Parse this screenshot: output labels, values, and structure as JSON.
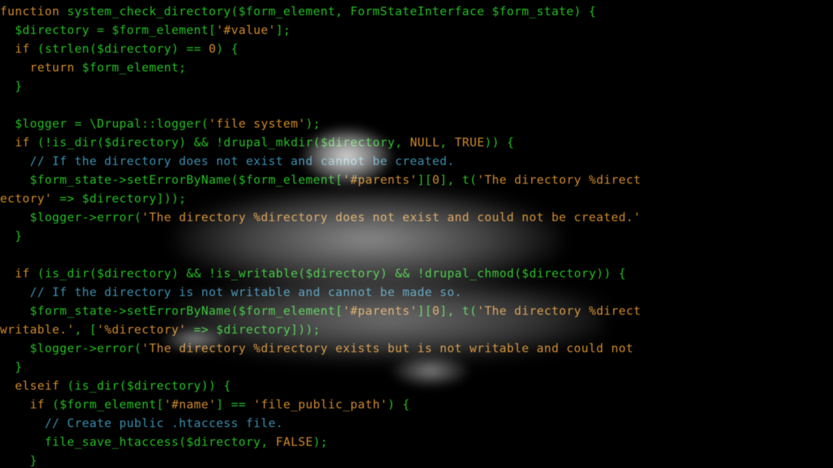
{
  "code": {
    "lines": [
      [
        {
          "t": "function ",
          "c": "kw"
        },
        {
          "t": "system_check_directory",
          "c": "fn"
        },
        {
          "t": "(",
          "c": "punc"
        },
        {
          "t": "$form_element",
          "c": "var"
        },
        {
          "t": ", ",
          "c": "punc"
        },
        {
          "t": "FormStateInterface ",
          "c": "cls"
        },
        {
          "t": "$form_state",
          "c": "var"
        },
        {
          "t": ") {",
          "c": "punc"
        }
      ],
      [
        {
          "t": "  ",
          "c": "punc"
        },
        {
          "t": "$directory",
          "c": "var"
        },
        {
          "t": " = ",
          "c": "op"
        },
        {
          "t": "$form_element",
          "c": "var"
        },
        {
          "t": "[",
          "c": "punc"
        },
        {
          "t": "'#value'",
          "c": "str"
        },
        {
          "t": "];",
          "c": "punc"
        }
      ],
      [
        {
          "t": "  ",
          "c": "punc"
        },
        {
          "t": "if ",
          "c": "kw"
        },
        {
          "t": "(",
          "c": "punc"
        },
        {
          "t": "strlen",
          "c": "fn"
        },
        {
          "t": "(",
          "c": "punc"
        },
        {
          "t": "$directory",
          "c": "var"
        },
        {
          "t": ") == ",
          "c": "op"
        },
        {
          "t": "0",
          "c": "num"
        },
        {
          "t": ") {",
          "c": "punc"
        }
      ],
      [
        {
          "t": "    ",
          "c": "punc"
        },
        {
          "t": "return ",
          "c": "kw"
        },
        {
          "t": "$form_element",
          "c": "var"
        },
        {
          "t": ";",
          "c": "punc"
        }
      ],
      [
        {
          "t": "  }",
          "c": "punc"
        }
      ],
      [
        {
          "t": " ",
          "c": "punc"
        }
      ],
      [
        {
          "t": "  ",
          "c": "punc"
        },
        {
          "t": "$logger",
          "c": "var"
        },
        {
          "t": " = ",
          "c": "op"
        },
        {
          "t": "\\Drupal",
          "c": "cls"
        },
        {
          "t": "::",
          "c": "op"
        },
        {
          "t": "logger",
          "c": "fn"
        },
        {
          "t": "(",
          "c": "punc"
        },
        {
          "t": "'file system'",
          "c": "str"
        },
        {
          "t": ");",
          "c": "punc"
        }
      ],
      [
        {
          "t": "  ",
          "c": "punc"
        },
        {
          "t": "if ",
          "c": "kw"
        },
        {
          "t": "(!",
          "c": "op"
        },
        {
          "t": "is_dir",
          "c": "fn"
        },
        {
          "t": "(",
          "c": "punc"
        },
        {
          "t": "$directory",
          "c": "var"
        },
        {
          "t": ") && !",
          "c": "op"
        },
        {
          "t": "drupal_mkdir",
          "c": "fn"
        },
        {
          "t": "(",
          "c": "punc"
        },
        {
          "t": "$directory",
          "c": "var"
        },
        {
          "t": ", ",
          "c": "punc"
        },
        {
          "t": "NULL",
          "c": "bool"
        },
        {
          "t": ", ",
          "c": "punc"
        },
        {
          "t": "TRUE",
          "c": "bool"
        },
        {
          "t": ")) {",
          "c": "punc"
        }
      ],
      [
        {
          "t": "    ",
          "c": "punc"
        },
        {
          "t": "// If the directory does not exist and cannot be created.",
          "c": "com"
        }
      ],
      [
        {
          "t": "    ",
          "c": "punc"
        },
        {
          "t": "$form_state",
          "c": "var"
        },
        {
          "t": "->",
          "c": "op"
        },
        {
          "t": "setErrorByName",
          "c": "fn"
        },
        {
          "t": "(",
          "c": "punc"
        },
        {
          "t": "$form_element",
          "c": "var"
        },
        {
          "t": "[",
          "c": "punc"
        },
        {
          "t": "'#parents'",
          "c": "str"
        },
        {
          "t": "][",
          "c": "punc"
        },
        {
          "t": "0",
          "c": "num"
        },
        {
          "t": "], ",
          "c": "punc"
        },
        {
          "t": "t",
          "c": "fn"
        },
        {
          "t": "(",
          "c": "punc"
        },
        {
          "t": "'The directory %direct",
          "c": "str"
        }
      ],
      [
        {
          "t": "ectory'",
          "c": "str"
        },
        {
          "t": " => ",
          "c": "op"
        },
        {
          "t": "$directory",
          "c": "var"
        },
        {
          "t": "]));",
          "c": "punc"
        }
      ],
      [
        {
          "t": "    ",
          "c": "punc"
        },
        {
          "t": "$logger",
          "c": "var"
        },
        {
          "t": "->",
          "c": "op"
        },
        {
          "t": "error",
          "c": "fn"
        },
        {
          "t": "(",
          "c": "punc"
        },
        {
          "t": "'The directory %directory does not exist and could not be created.'",
          "c": "str"
        }
      ],
      [
        {
          "t": "  }",
          "c": "punc"
        }
      ],
      [
        {
          "t": " ",
          "c": "punc"
        }
      ],
      [
        {
          "t": "  ",
          "c": "punc"
        },
        {
          "t": "if ",
          "c": "kw"
        },
        {
          "t": "(",
          "c": "punc"
        },
        {
          "t": "is_dir",
          "c": "fn"
        },
        {
          "t": "(",
          "c": "punc"
        },
        {
          "t": "$directory",
          "c": "var"
        },
        {
          "t": ") && !",
          "c": "op"
        },
        {
          "t": "is_writable",
          "c": "fn"
        },
        {
          "t": "(",
          "c": "punc"
        },
        {
          "t": "$directory",
          "c": "var"
        },
        {
          "t": ") && !",
          "c": "op"
        },
        {
          "t": "drupal_chmod",
          "c": "fn"
        },
        {
          "t": "(",
          "c": "punc"
        },
        {
          "t": "$directory",
          "c": "var"
        },
        {
          "t": ")) {",
          "c": "punc"
        }
      ],
      [
        {
          "t": "    ",
          "c": "punc"
        },
        {
          "t": "// If the directory is not writable and cannot be made so.",
          "c": "com"
        }
      ],
      [
        {
          "t": "    ",
          "c": "punc"
        },
        {
          "t": "$form_state",
          "c": "var"
        },
        {
          "t": "->",
          "c": "op"
        },
        {
          "t": "setErrorByName",
          "c": "fn"
        },
        {
          "t": "(",
          "c": "punc"
        },
        {
          "t": "$form_element",
          "c": "var"
        },
        {
          "t": "[",
          "c": "punc"
        },
        {
          "t": "'#parents'",
          "c": "str"
        },
        {
          "t": "][",
          "c": "punc"
        },
        {
          "t": "0",
          "c": "num"
        },
        {
          "t": "], ",
          "c": "punc"
        },
        {
          "t": "t",
          "c": "fn"
        },
        {
          "t": "(",
          "c": "punc"
        },
        {
          "t": "'The directory %direct",
          "c": "str"
        }
      ],
      [
        {
          "t": "writable.'",
          "c": "str"
        },
        {
          "t": ", [",
          "c": "punc"
        },
        {
          "t": "'%directory'",
          "c": "str"
        },
        {
          "t": " => ",
          "c": "op"
        },
        {
          "t": "$directory",
          "c": "var"
        },
        {
          "t": "]));",
          "c": "punc"
        }
      ],
      [
        {
          "t": "    ",
          "c": "punc"
        },
        {
          "t": "$logger",
          "c": "var"
        },
        {
          "t": "->",
          "c": "op"
        },
        {
          "t": "error",
          "c": "fn"
        },
        {
          "t": "(",
          "c": "punc"
        },
        {
          "t": "'The directory %directory exists but is not writable and could not ",
          "c": "str"
        }
      ],
      [
        {
          "t": "  }",
          "c": "punc"
        }
      ],
      [
        {
          "t": "  ",
          "c": "punc"
        },
        {
          "t": "elseif ",
          "c": "kw"
        },
        {
          "t": "(",
          "c": "punc"
        },
        {
          "t": "is_dir",
          "c": "fn"
        },
        {
          "t": "(",
          "c": "punc"
        },
        {
          "t": "$directory",
          "c": "var"
        },
        {
          "t": ")) {",
          "c": "punc"
        }
      ],
      [
        {
          "t": "    ",
          "c": "punc"
        },
        {
          "t": "if ",
          "c": "kw"
        },
        {
          "t": "(",
          "c": "punc"
        },
        {
          "t": "$form_element",
          "c": "var"
        },
        {
          "t": "[",
          "c": "punc"
        },
        {
          "t": "'#name'",
          "c": "str"
        },
        {
          "t": "] == ",
          "c": "op"
        },
        {
          "t": "'file_public_path'",
          "c": "str"
        },
        {
          "t": ") {",
          "c": "punc"
        }
      ],
      [
        {
          "t": "      ",
          "c": "punc"
        },
        {
          "t": "// Create public .htaccess file.",
          "c": "com"
        }
      ],
      [
        {
          "t": "      ",
          "c": "punc"
        },
        {
          "t": "file_save_htaccess",
          "c": "fn"
        },
        {
          "t": "(",
          "c": "punc"
        },
        {
          "t": "$directory",
          "c": "var"
        },
        {
          "t": ", ",
          "c": "punc"
        },
        {
          "t": "FALSE",
          "c": "bool"
        },
        {
          "t": ");",
          "c": "punc"
        }
      ],
      [
        {
          "t": "    }",
          "c": "punc"
        }
      ]
    ]
  }
}
